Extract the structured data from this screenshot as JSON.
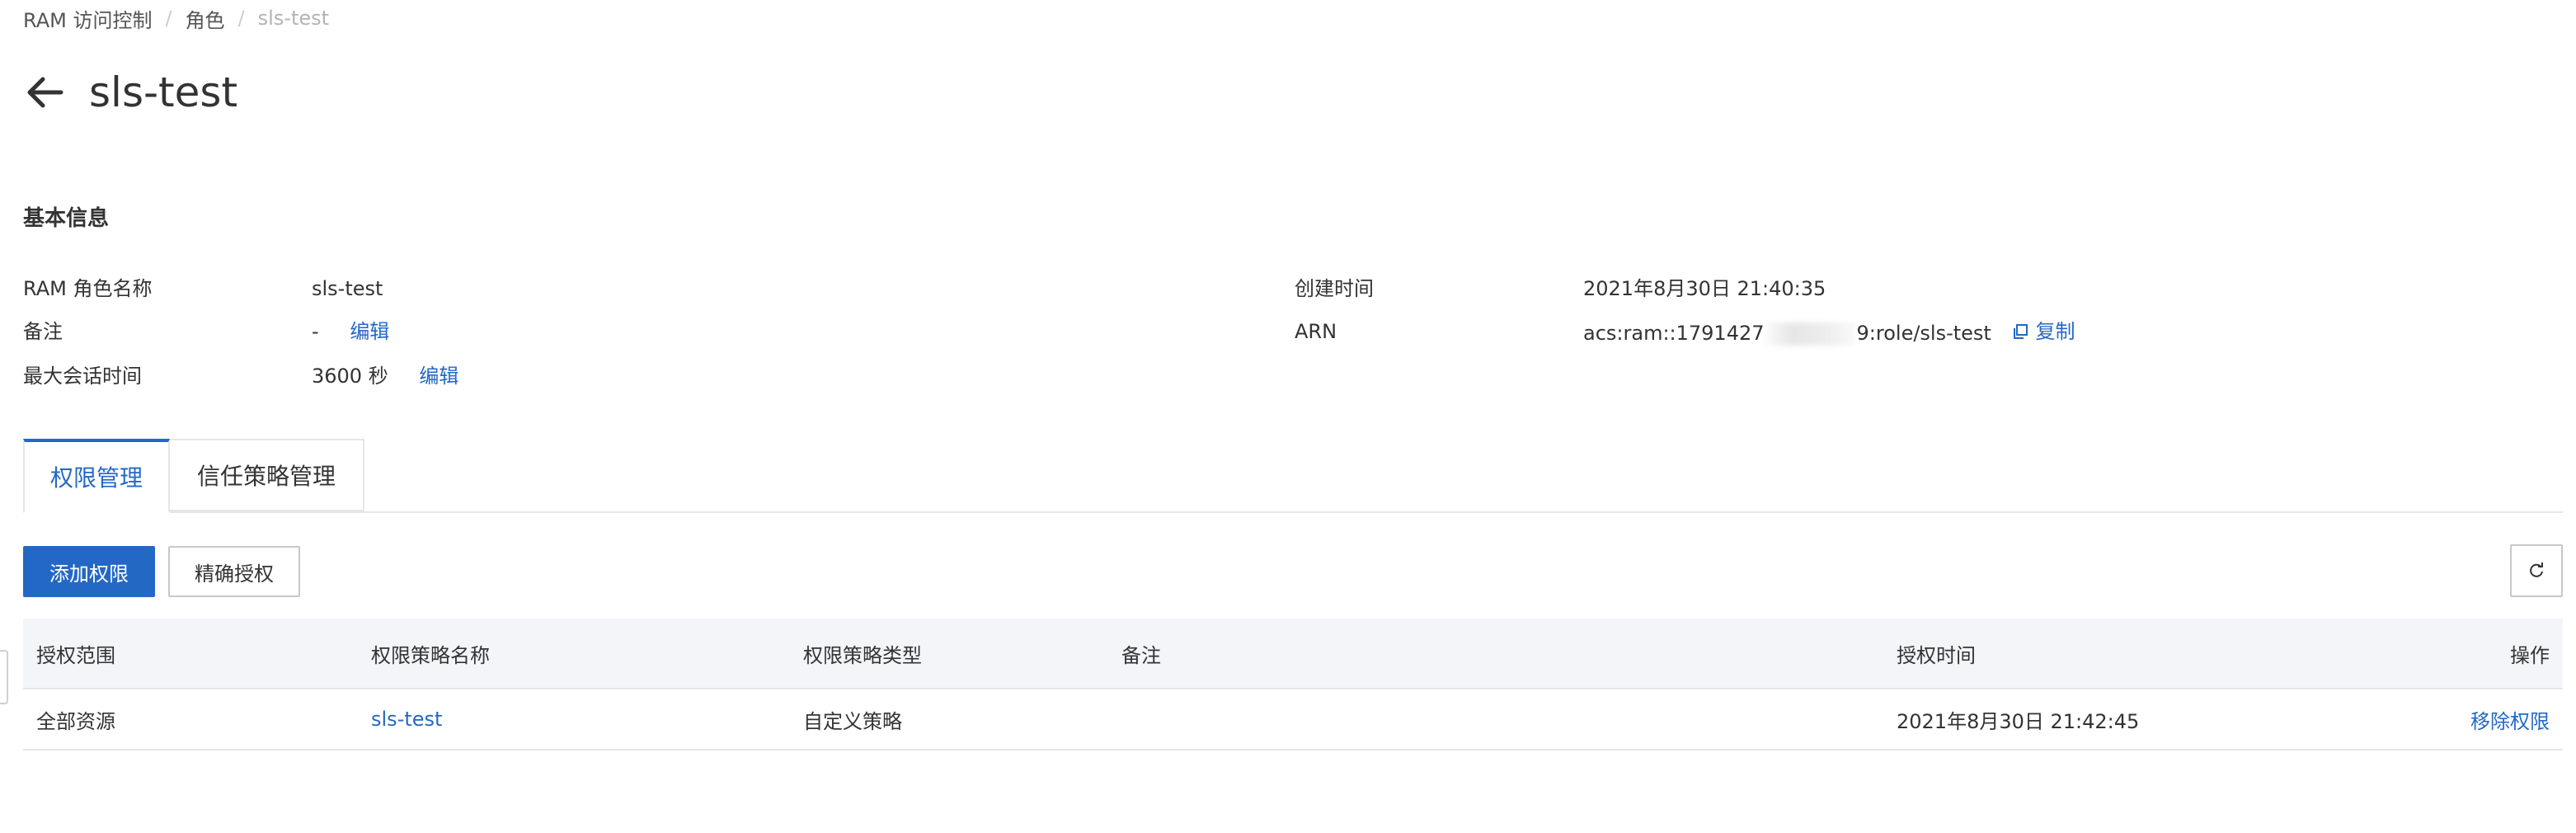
{
  "breadcrumb": {
    "items": [
      "RAM 访问控制",
      "角色",
      "sls-test"
    ],
    "separator": "/"
  },
  "header": {
    "title": "sls-test",
    "back_icon": "arrow-left-icon"
  },
  "basic_info": {
    "section_title": "基本信息",
    "role_name_label": "RAM 角色名称",
    "role_name_value": "sls-test",
    "note_label": "备注",
    "note_value": "-",
    "note_edit": "编辑",
    "max_session_label": "最大会话时间",
    "max_session_value": "3600 秒",
    "max_session_edit": "编辑",
    "created_label": "创建时间",
    "created_value": "2021年8月30日 21:40:35",
    "arn_label": "ARN",
    "arn_prefix": "acs:ram::1791427",
    "arn_suffix": "9:role/sls-test",
    "arn_copy": "复制"
  },
  "tabs": [
    {
      "label": "权限管理",
      "active": true
    },
    {
      "label": "信任策略管理",
      "active": false
    }
  ],
  "toolbar": {
    "add_permission": "添加权限",
    "precise_auth": "精确授权",
    "refresh_icon": "refresh-icon"
  },
  "table": {
    "columns": [
      "授权范围",
      "权限策略名称",
      "权限策略类型",
      "备注",
      "授权时间",
      "操作"
    ],
    "rows": [
      {
        "scope": "全部资源",
        "policy_name": "sls-test",
        "policy_type": "自定义策略",
        "note": "",
        "auth_time": "2021年8月30日 21:42:45",
        "action": "移除权限"
      }
    ]
  },
  "colors": {
    "primary": "#2468c5",
    "text": "#333333",
    "muted": "#b3b3b3",
    "header_bg": "#f3f5f8",
    "border": "#e6e6e6"
  }
}
